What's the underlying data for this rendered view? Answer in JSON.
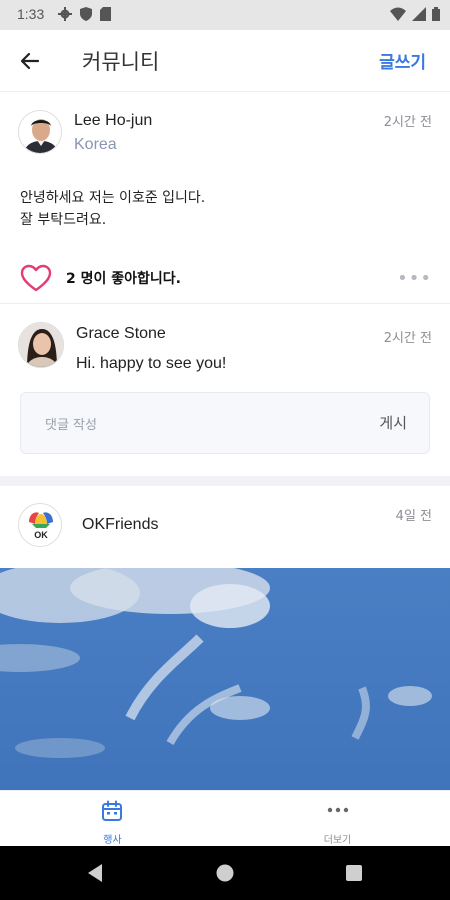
{
  "status_bar": {
    "time": "1:33"
  },
  "app_bar": {
    "title": "커뮤니티",
    "write_label": "글쓰기"
  },
  "post1": {
    "author": "Lee Ho-jun",
    "location": "Korea",
    "time": "2시간 전",
    "body_line1": "안녕하세요 저는 이호준 입니다.",
    "body_line2": "잘 부탁드려요.",
    "likes_text": "2 명이 좋아합니다."
  },
  "comment": {
    "author": "Grace Stone",
    "time": "2시간 전",
    "text": "Hi. happy to see you!"
  },
  "comment_input": {
    "placeholder": "댓글 작성",
    "post_label": "게시"
  },
  "post2": {
    "author": "OKFriends",
    "time": "4일 전",
    "logo_text": "OK"
  },
  "bottom_nav": {
    "items": [
      {
        "label": "행사",
        "icon": "calendar-icon",
        "active": true
      },
      {
        "label": "더보기",
        "icon": "more-icon",
        "active": false
      }
    ]
  },
  "colors": {
    "accent": "#3a7ae0",
    "like_heart": "#e23d74"
  }
}
